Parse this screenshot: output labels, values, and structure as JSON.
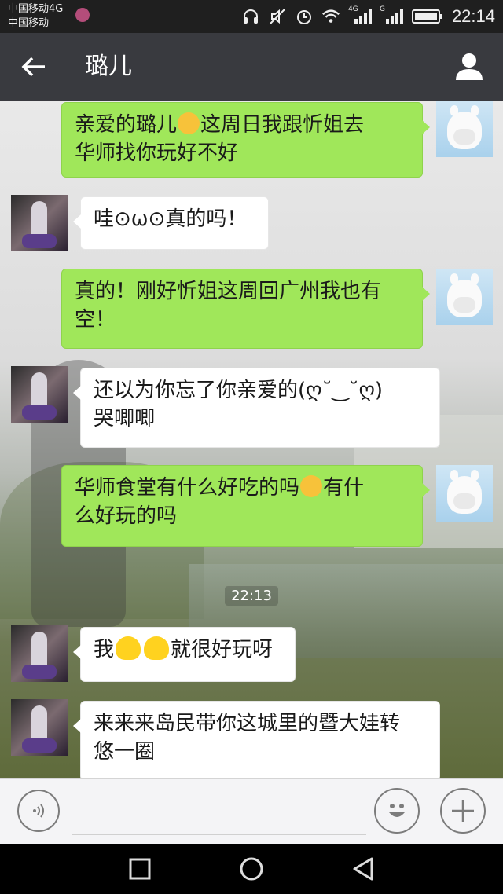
{
  "status_bar": {
    "carrier_line1": "中国移动4G",
    "carrier_line2": "中国移动",
    "net_label_1": "4G",
    "net_label_2": "G",
    "time": "22:14"
  },
  "header": {
    "title": "璐儿"
  },
  "messages": [
    {
      "side": "out",
      "parts": [
        "亲爱的璐儿",
        "这周日我跟忻姐去",
        "华师找你玩好不好"
      ]
    },
    {
      "side": "in",
      "text": "哇⊙ω⊙真的吗！"
    },
    {
      "side": "out",
      "line1": "真的！刚好忻姐这周回广州我也有",
      "line2": "空！"
    },
    {
      "side": "in",
      "line1": "还以为你忘了你亲爱的(ღ˘‿˘ღ)",
      "line2": "哭唧唧"
    },
    {
      "side": "out",
      "part1": "华师食堂有什么好吃的吗",
      "part2": "有什",
      "line2": "么好玩的吗"
    },
    {
      "side": "in",
      "part1": "我",
      "part2": "就很好玩呀"
    },
    {
      "side": "in",
      "line1": "来来来岛民带你这城里的暨大娃转",
      "line2": "悠一圈"
    }
  ],
  "timestamp": "22:13",
  "input": {
    "value": "",
    "placeholder": ""
  },
  "icons": {
    "back": "arrow-left-icon",
    "profile": "person-icon",
    "voice": "voice-icon",
    "emoji": "smiley-icon",
    "plus": "plus-icon",
    "nav_recent": "square-icon",
    "nav_home": "circle-icon",
    "nav_back": "triangle-back-icon"
  },
  "colors": {
    "header_bg": "#393a3f",
    "out_bubble": "#a0e75a",
    "in_bubble": "#ffffff",
    "status_bar_bg": "#1f1f1f"
  }
}
